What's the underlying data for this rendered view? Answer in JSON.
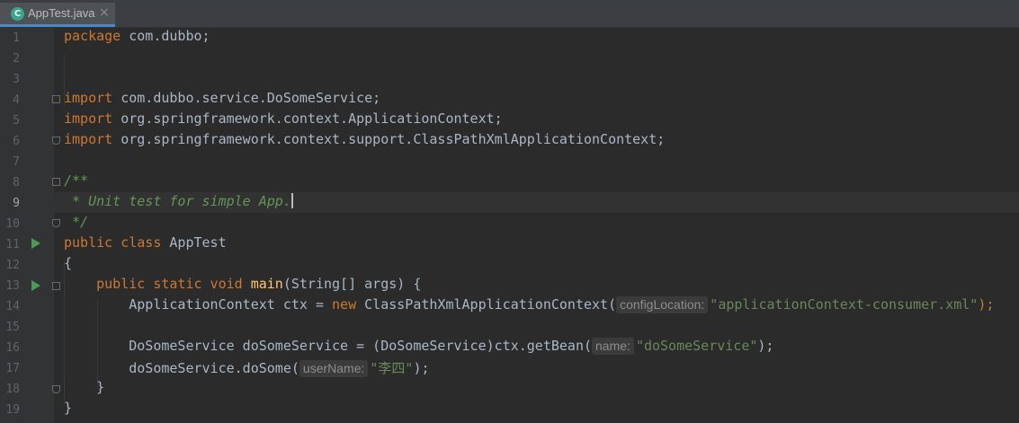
{
  "tab": {
    "icon_letter": "C",
    "filename": "AppTest.java",
    "close_glyph": "×"
  },
  "line_numbers": [
    "1",
    "2",
    "3",
    "4",
    "5",
    "6",
    "7",
    "8",
    "9",
    "10",
    "11",
    "12",
    "13",
    "14",
    "15",
    "16",
    "17",
    "18",
    "19"
  ],
  "code": {
    "l1": {
      "kw": "package",
      "rest": " com.dubbo;"
    },
    "l4": {
      "kw": "import",
      "rest": " com.dubbo.service.DoSomeService;"
    },
    "l5": {
      "kw": "import",
      "rest": " org.springframework.context.ApplicationContext;"
    },
    "l6": {
      "kw": "import",
      "rest": " org.springframework.context.support.ClassPathXmlApplicationContext;"
    },
    "l8": {
      "cmt": "/**"
    },
    "l9": {
      "cmt": " * Unit test for simple App."
    },
    "l10": {
      "cmt": " */"
    },
    "l11": {
      "kw": "public class",
      "rest": " AppTest"
    },
    "l12": {
      "text": "{"
    },
    "l13": {
      "indent": "    ",
      "kw": "public static void",
      "fn": "main",
      "rest": "(String[] args) {"
    },
    "l14": {
      "indent": "        ",
      "pre": "ApplicationContext ctx = ",
      "kw": "new",
      "mid": " ClassPathXmlApplicationContext(",
      "hint": "configLocation:",
      "str": "\"applicationContext-consumer.xml\"",
      "post": ");"
    },
    "l16": {
      "indent": "        ",
      "pre": "DoSomeService doSomeService = (DoSomeService)ctx.getBean(",
      "hint": "name:",
      "str": "\"doSomeService\"",
      "post": ");"
    },
    "l17": {
      "indent": "        ",
      "pre": "doSomeService.doSome(",
      "hint": "userName:",
      "str": "\"李四\"",
      "post": ");"
    },
    "l18": {
      "text": "    }"
    },
    "l19": {
      "text": "}"
    }
  },
  "colors": {
    "background": "#2b2b2b",
    "keyword": "#cc7832",
    "comment": "#629755",
    "string": "#6a8759",
    "method": "#ffc66d",
    "text": "#a9b7c6"
  },
  "current_line": "9"
}
